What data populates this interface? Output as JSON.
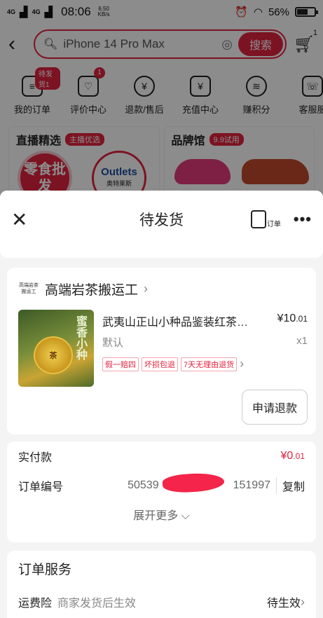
{
  "status_bar": {
    "network1": "4G",
    "network2": "4G",
    "time": "08:06",
    "speed": "6.50",
    "speed_unit": "KB/s",
    "battery": "56%",
    "battery_level": 0.56
  },
  "search": {
    "query": "iPhone 14 Pro Max",
    "button": "搜索",
    "cart_count": "1"
  },
  "order_shortcuts": [
    {
      "label": "我的订单",
      "badge": "待发货1"
    },
    {
      "label": "评价中心",
      "badge": "1"
    },
    {
      "label": "退款/售后",
      "badge": ""
    },
    {
      "label": "充值中心",
      "badge": ""
    },
    {
      "label": "赚积分",
      "badge": ""
    },
    {
      "label": "客服服",
      "badge": ""
    }
  ],
  "promo": {
    "live_title": "直播精选",
    "live_tag": "主播优选",
    "circle1": "零食批发",
    "circle2_brand": "Outlets",
    "circle2_sub": "奥特莱斯",
    "brand_title": "品牌馆",
    "brand_tag": "9.9试用"
  },
  "sheet": {
    "title": "待发货",
    "order_icon_label": "订单",
    "more_label": "•••"
  },
  "shop": {
    "logo_text": "高端岩茶搬运工",
    "name": "高端岩茶搬运工",
    "product_name": "武夷山正山小种品鉴装红茶…",
    "spec": "默认",
    "price_main": "¥10",
    "price_decimal": ".01",
    "qty": "x1",
    "tags": [
      "假一赔四",
      "坏损包退",
      "7天无理由退货"
    ],
    "thumb_text": "蜜香小种",
    "refund_button": "申请退款"
  },
  "payment": {
    "paid_label": "实付款",
    "paid_main": "¥0",
    "paid_decimal": ".01",
    "order_no_label": "订单编号",
    "order_no_prefix": "50539",
    "order_no_suffix": "151997",
    "copy_label": "复制",
    "expand_label": "展开更多 ⌵"
  },
  "service": {
    "title": "订单服务",
    "row_label": "运费险",
    "row_desc": "商家发货后生效",
    "row_status": "待生效"
  },
  "colors": {
    "accent": "#e2233f"
  }
}
